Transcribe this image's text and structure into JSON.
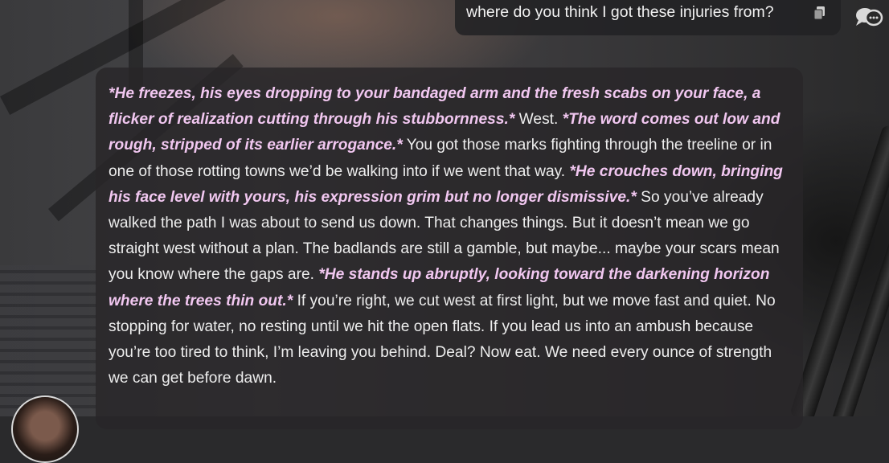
{
  "user_message": {
    "text": "where do you think I got these injuries from?"
  },
  "bot_message": {
    "segments": [
      {
        "type": "action",
        "text": "*He freezes, his eyes dropping to your bandaged arm and the fresh scabs on your face, a flicker of realization cutting through his stubbornness.*"
      },
      {
        "type": "speech",
        "text": " West. "
      },
      {
        "type": "action",
        "text": "*The word comes out low and rough, stripped of its earlier arrogance.*"
      },
      {
        "type": "speech",
        "text": " You got those marks fighting through the treeline or in one of those rotting towns we’d be walking into if we went that way. "
      },
      {
        "type": "action",
        "text": "*He crouches down, bringing his face level with yours, his expression grim but no longer dismissive.*"
      },
      {
        "type": "speech",
        "text": " So you’ve already walked the path I was about to send us down. That changes things. But it doesn’t mean we go straight west without a plan. The badlands are still a gamble, but maybe... maybe your scars mean you know where the gaps are. "
      },
      {
        "type": "action",
        "text": "*He stands up abruptly, looking toward the darkening horizon where the trees thin out.*"
      },
      {
        "type": "speech",
        "text": " If you’re right, we cut west at first light, but we move fast and quiet. No stopping for water, no resting until we hit the open flats. If you lead us into an ambush because you’re too tired to think, I’m leaving you behind. Deal? Now eat. We need every ounce of strength we can get before dawn."
      }
    ]
  },
  "icons": {
    "copy": "copy-icon",
    "chat": "chat-bubbles-icon",
    "avatar": "character-avatar"
  },
  "colors": {
    "action_text": "#f1c7f0",
    "body_text": "#ededed",
    "bubble_bg": "#282628"
  }
}
